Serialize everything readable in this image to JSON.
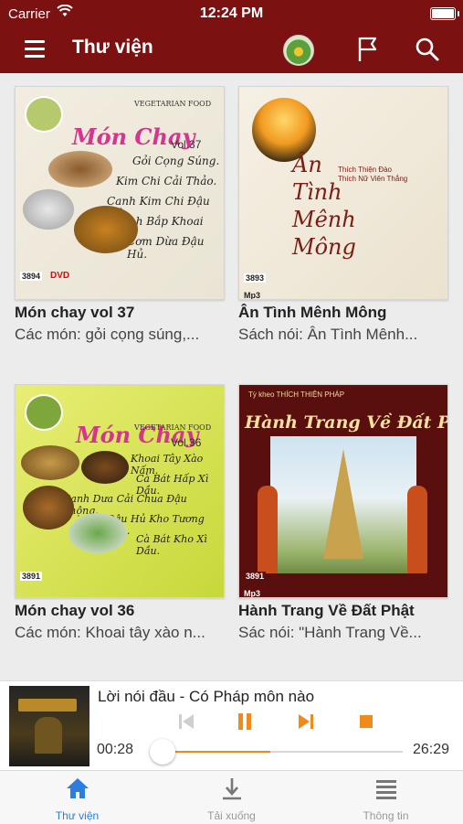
{
  "status": {
    "carrier": "Carrier",
    "time": "12:24 PM"
  },
  "nav": {
    "title": "Thư viện"
  },
  "books": [
    {
      "title": "Món chay vol 37",
      "desc": "Các món: gỏi cọng súng,...",
      "cover_title": "Món Chay",
      "cover_vol": "Vol.37",
      "cover_sub": "VEGETARIAN FOOD",
      "code": "3894",
      "format": "DVD",
      "lines": [
        "Gỏi Cọng Súng.",
        "Kim Chi Cải Thảo.",
        "Canh Kim Chi Đậu Hủ.",
        "Bánh Bắp Khoai Mỡ.",
        "Cơm Dừa Đậu Hủ."
      ]
    },
    {
      "title": "Ân Tình Mênh Mông",
      "desc": "Sách nói: Ân Tình Mênh...",
      "cover_title": "Ân Tình Mênh Mông",
      "code": "3893",
      "format": "Mp3",
      "lines": [
        "Thích Thiện Đào",
        "Thích Nữ Viên Thắng"
      ]
    },
    {
      "title": "Món chay vol 36",
      "desc": "Các món: Khoai tây xào n...",
      "cover_title": "Món Chay",
      "cover_vol": "Vol.36",
      "cover_sub": "VEGETARIAN FOOD",
      "code": "3891",
      "format": "",
      "lines": [
        "Khoai Tây Xào Nấm.",
        "Cà Bát Hấp Xì Dầu.",
        "Canh Dưa Cải Chua Đậu Phộng.",
        "Đậu Hủ Kho Tương Bần.",
        "Cà Bát Kho Xì Dầu."
      ]
    },
    {
      "title": "Hành Trang Về Đất Phật",
      "desc": "Sác nói: \"Hành Trang Về...",
      "cover_title": "Hành Trang Về Đất Phật",
      "code": "3891",
      "format": "Mp3",
      "lines": [
        "Tỳ kheo THÍCH THIỆN PHÁP"
      ]
    }
  ],
  "player": {
    "title": "Lời nói đầu - Có Pháp môn nào",
    "current_time": "00:28",
    "total_time": "26:29",
    "progress": 0.44
  },
  "tabs": [
    {
      "label": "Thư viện",
      "icon": "home-icon",
      "active": true
    },
    {
      "label": "Tải xuống",
      "icon": "download-icon",
      "active": false
    },
    {
      "label": "Thông tin",
      "icon": "info-list-icon",
      "active": false
    }
  ],
  "colors": {
    "header": "#7c1111",
    "accent": "#f08a1a",
    "tab_active": "#2b7ee0"
  }
}
